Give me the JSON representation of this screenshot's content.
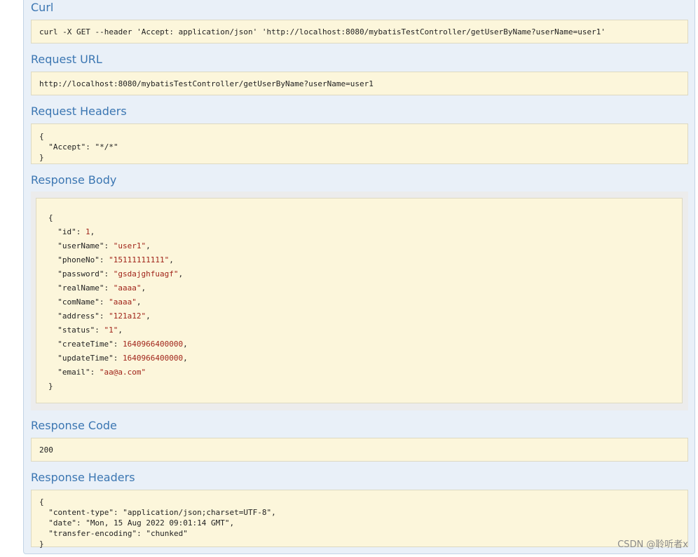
{
  "sections": {
    "curl": {
      "title": "Curl",
      "command": "curl -X GET --header 'Accept: application/json' 'http://localhost:8080/mybatisTestController/getUserByName?userName=user1'"
    },
    "request_url": {
      "title": "Request URL",
      "value": "http://localhost:8080/mybatisTestController/getUserByName?userName=user1"
    },
    "request_headers": {
      "title": "Request Headers",
      "lines": [
        "{",
        "  \"Accept\": \"*/*\"",
        "}"
      ]
    },
    "response_body": {
      "title": "Response Body",
      "open": "{",
      "close": "}",
      "fields": [
        {
          "key": "\"id\"",
          "value": "1",
          "kind": "number"
        },
        {
          "key": "\"userName\"",
          "value": "\"user1\"",
          "kind": "string"
        },
        {
          "key": "\"phoneNo\"",
          "value": "\"15111111111\"",
          "kind": "string"
        },
        {
          "key": "\"password\"",
          "value": "\"gsdajghfuagf\"",
          "kind": "string"
        },
        {
          "key": "\"realName\"",
          "value": "\"aaaa\"",
          "kind": "string"
        },
        {
          "key": "\"comName\"",
          "value": "\"aaaa\"",
          "kind": "string"
        },
        {
          "key": "\"address\"",
          "value": "\"121a12\"",
          "kind": "string"
        },
        {
          "key": "\"status\"",
          "value": "\"1\"",
          "kind": "string"
        },
        {
          "key": "\"createTime\"",
          "value": "1640966400000",
          "kind": "number"
        },
        {
          "key": "\"updateTime\"",
          "value": "1640966400000",
          "kind": "number"
        },
        {
          "key": "\"email\"",
          "value": "\"aa@a.com\"",
          "kind": "string",
          "last": true
        }
      ]
    },
    "response_code": {
      "title": "Response Code",
      "value": "200"
    },
    "response_headers": {
      "title": "Response Headers",
      "lines": [
        "{",
        "  \"content-type\": \"application/json;charset=UTF-8\",",
        "  \"date\": \"Mon, 15 Aug 2022 09:01:14 GMT\",",
        "  \"transfer-encoding\": \"chunked\"",
        "}"
      ]
    }
  },
  "watermark": "CSDN @聆听者x",
  "colors": {
    "panel_bg": "#e9f0f8",
    "heading": "#3b76b2",
    "code_bg": "#fcf6db",
    "value": "#a0241a"
  }
}
